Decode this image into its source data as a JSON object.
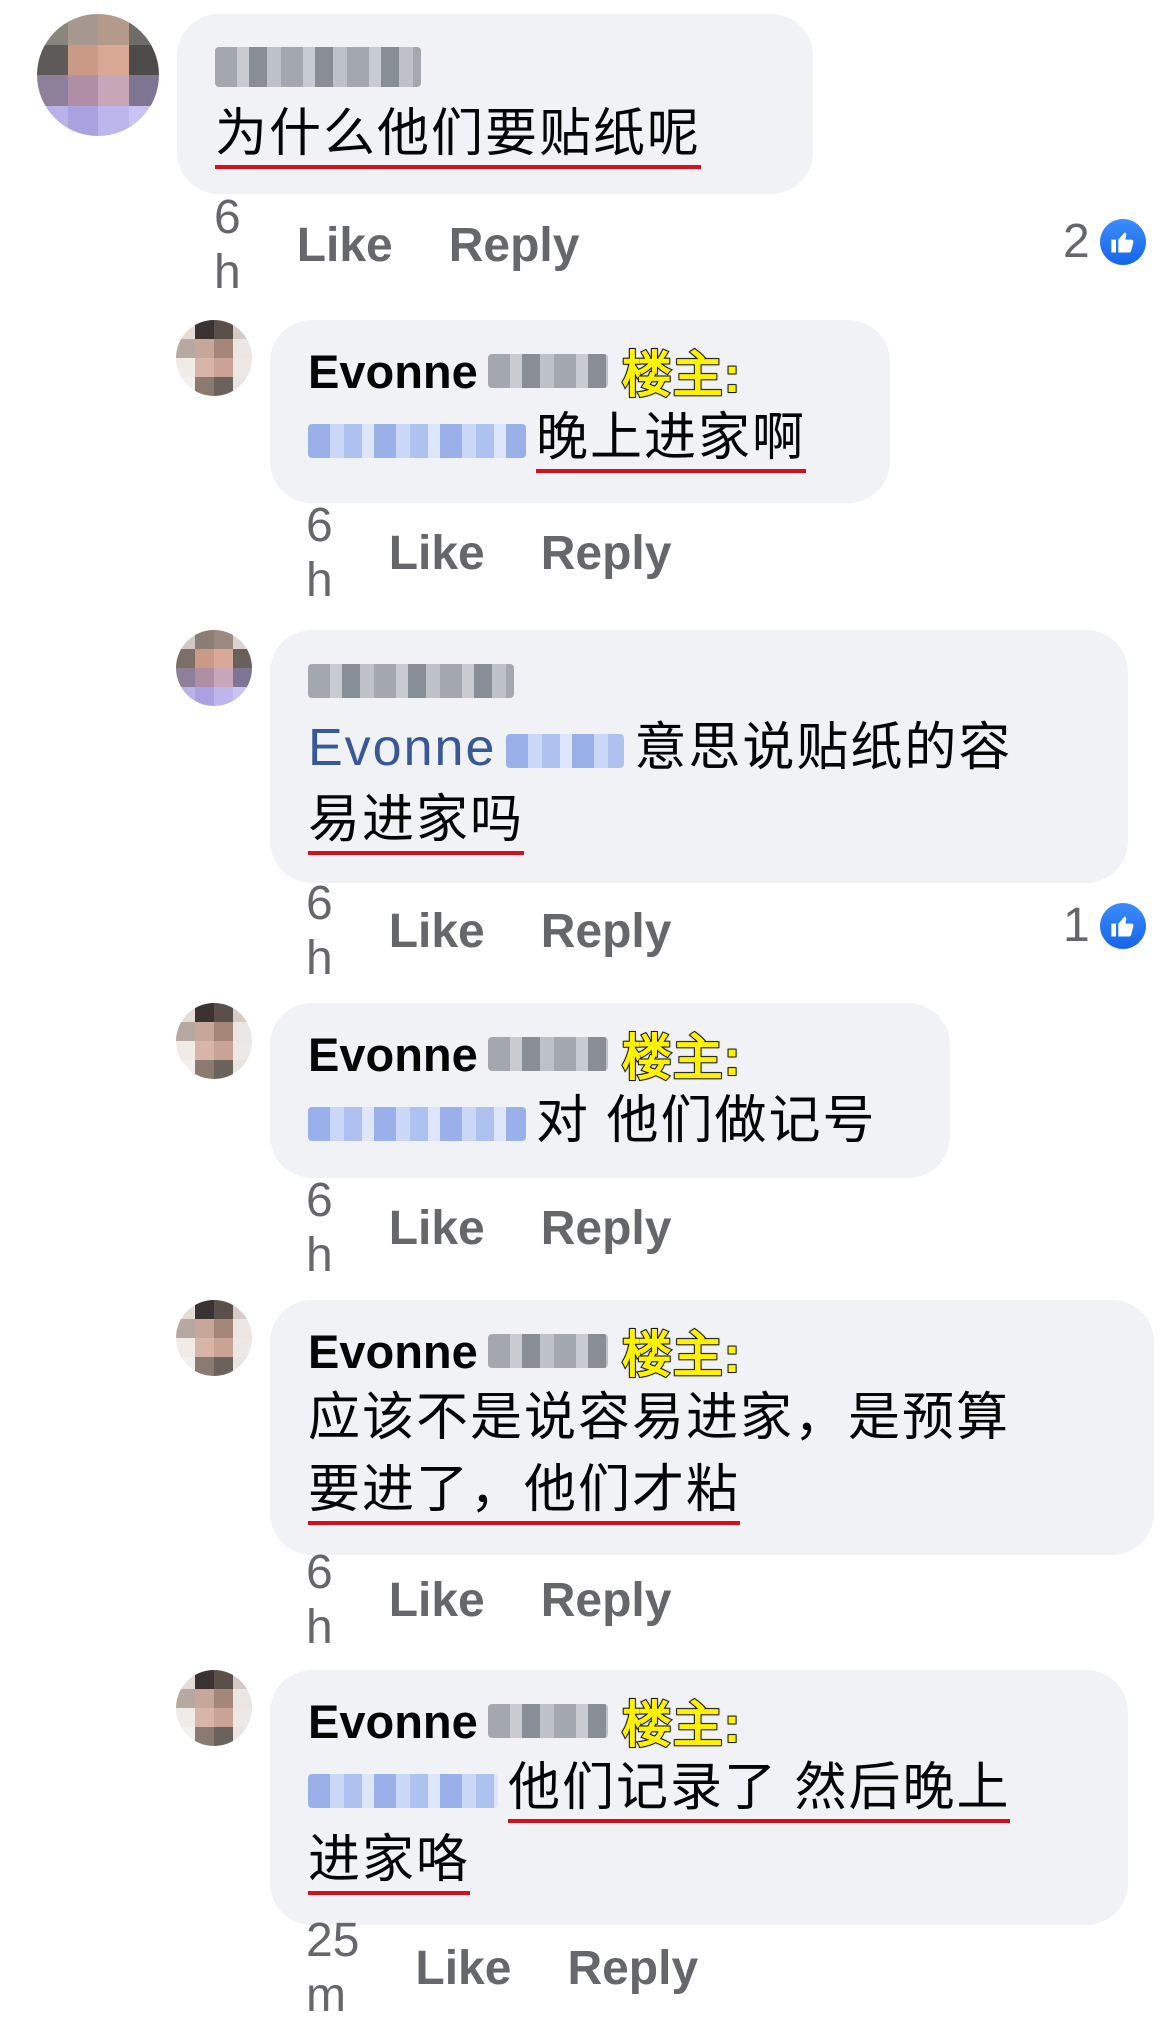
{
  "colors": {
    "bubble": "#f0f2f5",
    "mention": "#385898",
    "meta": "#65676b",
    "underline": "#d90b1c",
    "badge": "#fff200",
    "like_blue": "#1877f2"
  },
  "icons": {
    "like": "thumbs-up-icon"
  },
  "actions": {
    "like": "Like",
    "reply": "Reply"
  },
  "comments": [
    {
      "author": "",
      "text": "为什么他们要贴纸呢",
      "time": "6 h",
      "reactions": "2"
    },
    {
      "author": "Evonne",
      "badge": "楼主:",
      "text": "晚上进家啊",
      "time": "6 h"
    },
    {
      "author": "",
      "mention": "Evonne",
      "text_line1": "意思说贴纸的容",
      "text_line2": "易进家吗",
      "time": "6 h",
      "reactions": "1"
    },
    {
      "author": "Evonne",
      "badge": "楼主:",
      "text": "对 他们做记号",
      "time": "6 h"
    },
    {
      "author": "Evonne",
      "badge": "楼主:",
      "text_line1": "应该不是说容易进家，是预算",
      "text_line2": "要进了，他们才粘",
      "time": "6 h"
    },
    {
      "author": "Evonne",
      "badge": "楼主:",
      "text_line1": "他们记录了 然后晚上",
      "text_line2": "进家咯",
      "time": "25 m"
    }
  ]
}
